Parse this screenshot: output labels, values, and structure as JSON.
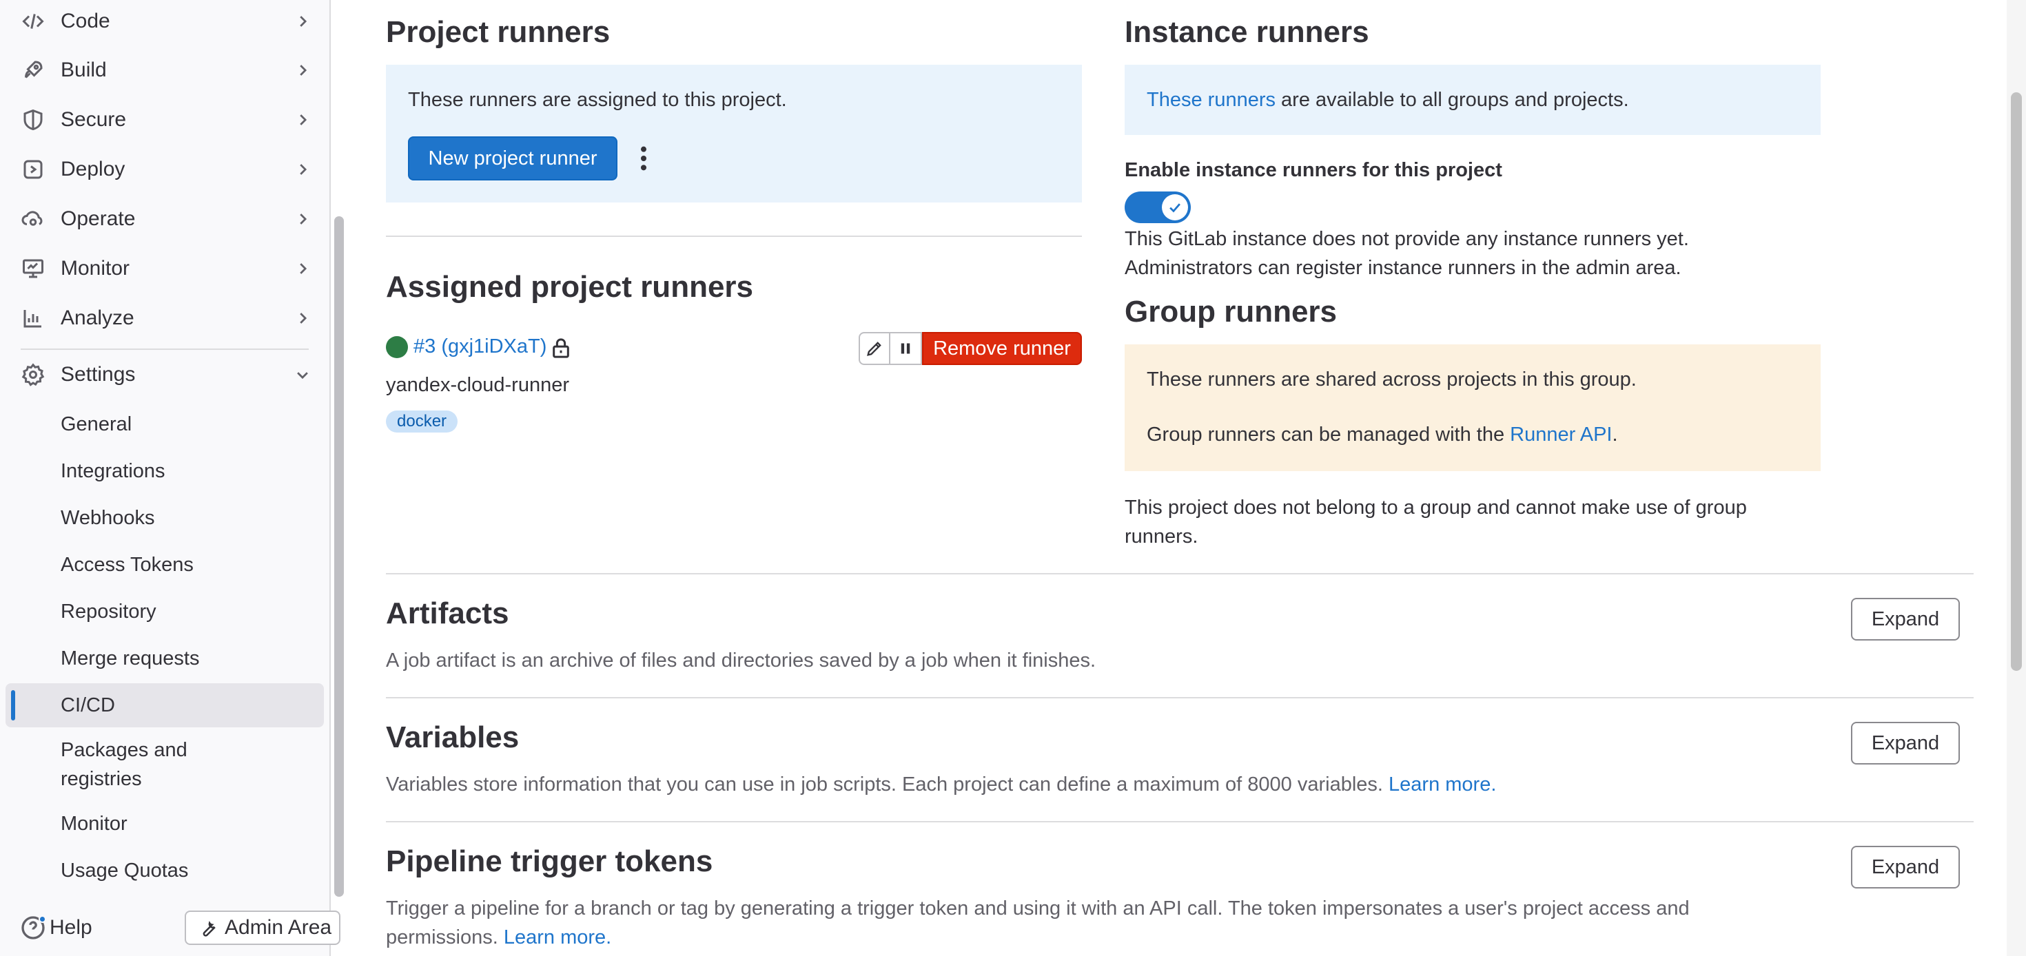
{
  "sidebar": {
    "nav": [
      {
        "label": "Code",
        "icon": "code-icon"
      },
      {
        "label": "Build",
        "icon": "rocket-icon"
      },
      {
        "label": "Secure",
        "icon": "shield-icon"
      },
      {
        "label": "Deploy",
        "icon": "deploy-icon"
      },
      {
        "label": "Operate",
        "icon": "cloud-gear-icon"
      },
      {
        "label": "Monitor",
        "icon": "monitor-icon"
      },
      {
        "label": "Analyze",
        "icon": "chart-icon"
      }
    ],
    "settings": {
      "label": "Settings",
      "icon": "gear-icon"
    },
    "settings_items": [
      {
        "label": "General"
      },
      {
        "label": "Integrations"
      },
      {
        "label": "Webhooks"
      },
      {
        "label": "Access Tokens"
      },
      {
        "label": "Repository"
      },
      {
        "label": "Merge requests"
      },
      {
        "label": "CI/CD"
      },
      {
        "label": "Packages and registries"
      },
      {
        "label": "Monitor"
      },
      {
        "label": "Usage Quotas"
      }
    ],
    "help_label": "Help",
    "admin_label": "Admin Area"
  },
  "project_runners": {
    "title": "Project runners",
    "info": "These runners are assigned to this project.",
    "new_button": "New project runner"
  },
  "assigned": {
    "title": "Assigned project runners",
    "runner_link": "#3 (gxj1iDXaT)",
    "runner_name": "yandex-cloud-runner",
    "tag": "docker",
    "remove_button": "Remove runner"
  },
  "instance_runners": {
    "title": "Instance runners",
    "info_link": "These runners",
    "info_rest": " are available to all groups and projects.",
    "toggle_label": "Enable instance runners for this project",
    "toggle_on": true,
    "note_line1": "This GitLab instance does not provide any instance runners yet.",
    "note_line2": "Administrators can register instance runners in the admin area."
  },
  "group_runners": {
    "title": "Group runners",
    "info1": "These runners are shared across projects in this group.",
    "info2_pre": "Group runners can be managed with the ",
    "info2_link": "Runner API",
    "info2_post": ".",
    "note": "This project does not belong to a group and cannot make use of group runners."
  },
  "sections": [
    {
      "title": "Artifacts",
      "desc": "A job artifact is an archive of files and directories saved by a job when it finishes.",
      "link": "",
      "button": "Expand"
    },
    {
      "title": "Variables",
      "desc": "Variables store information that you can use in job scripts. Each project can define a maximum of 8000 variables.",
      "link": "Learn more.",
      "button": "Expand"
    },
    {
      "title": "Pipeline trigger tokens",
      "desc": "Trigger a pipeline for a branch or tag by generating a trigger token and using it with an API call. The token impersonates a user's project access and permissions.",
      "link": "Learn more.",
      "button": "Expand"
    }
  ],
  "colors": {
    "accent": "#1f75cb",
    "danger": "#dd2b0e",
    "success": "#2d7d45",
    "info_bg": "#e9f3fc",
    "warning_bg": "#fcf1df"
  }
}
